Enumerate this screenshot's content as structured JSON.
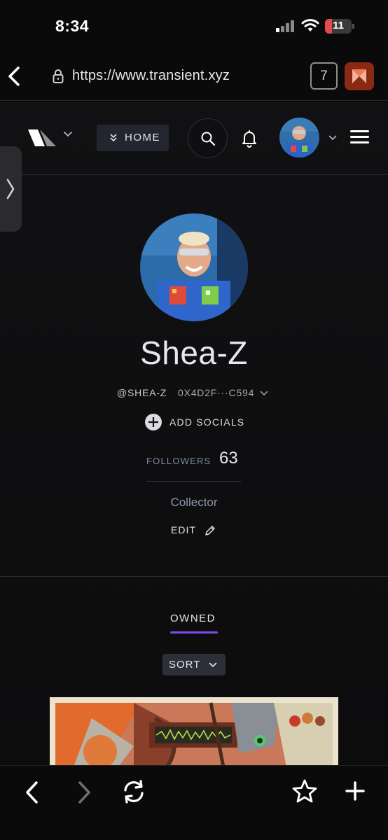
{
  "status_bar": {
    "time": "8:34",
    "battery_level": "11",
    "battery_color": "#e5484d"
  },
  "browser": {
    "url": "https://www.transient.xyz",
    "tab_count": "7"
  },
  "site_header": {
    "home_label": "HOME",
    "icons": [
      "logo-icon",
      "chevron-down-icon",
      "home-chevrons-icon",
      "search-icon",
      "bell-icon",
      "avatar",
      "chevron-down-icon",
      "menu-icon"
    ]
  },
  "profile": {
    "name": "Shea-Z",
    "handle": "@SHEA-Z",
    "address": "0X4D2F···C594",
    "add_socials_label": "ADD SOCIALS",
    "followers_label": "FOLLOWERS",
    "followers_count": "63",
    "role": "Collector",
    "edit_label": "EDIT"
  },
  "content": {
    "tabs": [
      {
        "label": "OWNED",
        "active": true
      }
    ],
    "sort_label": "SORT",
    "accent_color": "#7d4cf0"
  },
  "toolbar": {
    "icons": [
      "back-icon",
      "forward-icon",
      "reload-icon",
      "bookmark-star-icon",
      "new-tab-plus-icon"
    ]
  }
}
